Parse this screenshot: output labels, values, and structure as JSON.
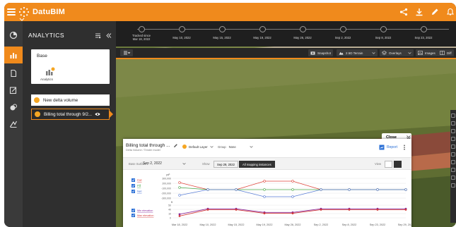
{
  "app": {
    "title": "DatuBIM"
  },
  "panel": {
    "title": "ANALYTICS",
    "base_card": {
      "label": "Base",
      "item_caption": "Analytics"
    },
    "items": [
      {
        "label": "New delta volume"
      },
      {
        "label": "Billing total through 9/2..."
      }
    ]
  },
  "timeline": {
    "labels": [
      "Tracked since\nMar 18, 2022",
      "May 10, 2022",
      "May 15, 2022",
      "May 19, 2022",
      "May 26, 2022",
      "Sep 2, 2022",
      "Sep 8, 2022",
      "Sep 23, 2022"
    ]
  },
  "toolbar": {
    "snapshot": "Snapshot",
    "terrain": "2.5D Terrain",
    "overlays": "Overlays",
    "images": "Images",
    "diff": "Diff"
  },
  "chart_panel": {
    "close": "Close",
    "title": "Billing total through ...",
    "subtitle": "Delta Volume / Tender model",
    "layer": "Default Layer",
    "group_label": "Group",
    "group_value": "None",
    "report": "Report",
    "base_surface_label": "Base Surface",
    "base_surface_value": "Sep 2, 2022",
    "show_label": "Show",
    "seg_date": "Sep 29, 2022",
    "seg_all": "All mapping instances",
    "view_label": "View"
  },
  "colors": {
    "brand": "#f08a1c",
    "series_cut": "#e0463d",
    "series_fill": "#4aa84a",
    "series_net": "#5b7fd6",
    "series_site": "#8a2a9a",
    "series_site2": "#d23a3a"
  },
  "chart_data": [
    {
      "type": "line",
      "title": "",
      "ylabel": "yd³",
      "x": [
        "Mar 18, 2022",
        "May 10, 2022",
        "May 15, 2022",
        "May 19, 2022",
        "May 26, 2022",
        "Sep 2, 2022",
        "Sep 8, 2022",
        "Sep 23, 2022",
        "Sep 29, 2022"
      ],
      "yticks": [
        "300,000",
        "200,000",
        "-100,000",
        "-200,000",
        "-300,000"
      ],
      "series": [
        {
          "name": "Cut",
          "values": [
            210000,
            160000,
            160000,
            220000,
            220000,
            160000,
            160000,
            160000,
            160000
          ]
        },
        {
          "name": "Fill",
          "values": [
            175000,
            160000,
            160000,
            160000,
            160000,
            160000,
            160000,
            160000,
            160000
          ]
        },
        {
          "name": "Net",
          "values": [
            120000,
            160000,
            160000,
            110000,
            110000,
            160000,
            160000,
            160000,
            160000
          ]
        }
      ],
      "legend": "left"
    },
    {
      "type": "line",
      "ylabel": "ft",
      "yticks": [
        "50",
        "40",
        "10",
        "0"
      ],
      "x": [
        "Mar 18, 2022",
        "May 10, 2022",
        "May 15, 2022",
        "May 19, 2022",
        "May 26, 2022",
        "Sep 2, 2022",
        "Sep 8, 2022",
        "Sep 23, 2022",
        "Sep 29, 2022"
      ],
      "series": [
        {
          "name": "Min elevation",
          "values": [
            22,
            28,
            28,
            24,
            24,
            28,
            28,
            28,
            28
          ]
        },
        {
          "name": "Max elevation",
          "values": [
            20,
            27,
            27,
            23,
            23,
            27,
            27,
            27,
            27
          ]
        }
      ],
      "legend": "left"
    }
  ]
}
